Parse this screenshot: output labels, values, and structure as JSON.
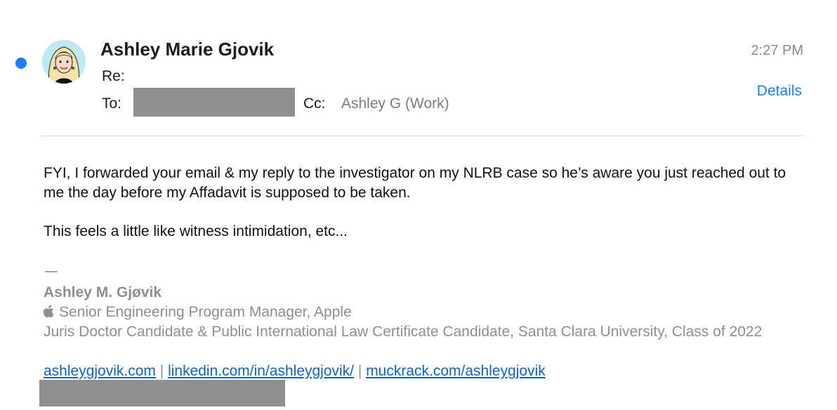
{
  "email": {
    "sender": "Ashley Marie Gjovik",
    "time": "2:27 PM",
    "re_label": "Re:",
    "to_label": "To:",
    "cc_label": "Cc:",
    "cc_value": "Ashley G (Work)",
    "details_label": "Details"
  },
  "body": {
    "paragraph1": "FYI, I forwarded your email & my reply to the investigator on my NLRB case so he’s aware you just reached out to me the day before my Affadavit is supposed to be taken.",
    "paragraph2": "This feels a little like witness intimidation, etc..."
  },
  "signature": {
    "dash": "—",
    "name": "Ashley M. Gjøvik",
    "title": "Senior Engineering Program Manager, Apple",
    "title_icon": "apple-logo-icon",
    "school": "Juris Doctor Candidate & Public International Law Certificate Candidate, Santa Clara University, Class of 2022",
    "links": [
      "ashleygjovik.com",
      "linkedin.com/in/ashleygjovik/",
      "muckrack.com/ashleygjovik"
    ],
    "separator": "|"
  },
  "colors": {
    "accent": "#1a7ef5",
    "link": "#1064c8",
    "redaction": "#8f8f8f",
    "muted": "#8e8e93"
  }
}
